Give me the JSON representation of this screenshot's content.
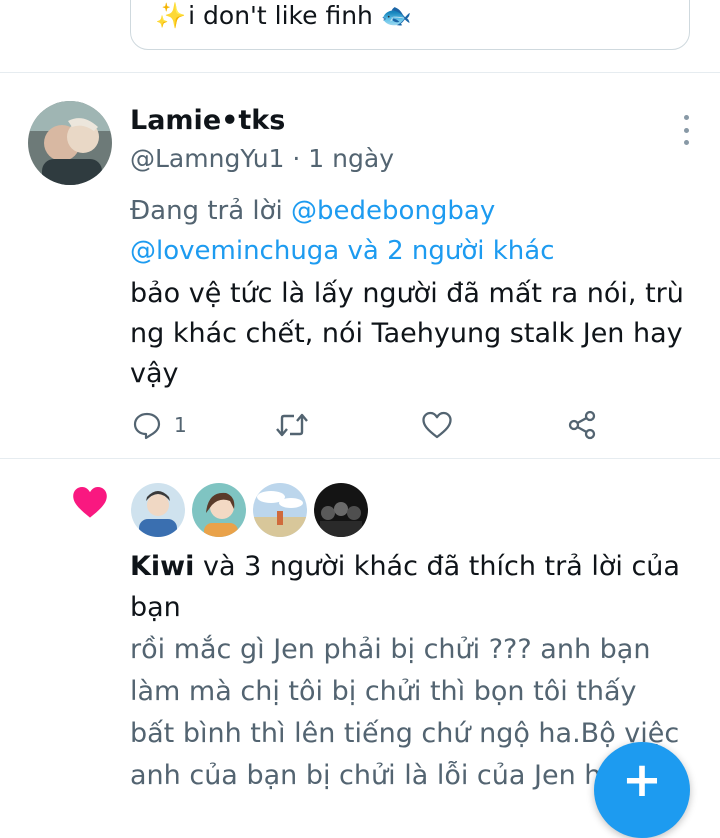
{
  "quoted_tweet": {
    "text": "i don't like finh",
    "sparkle": "✨",
    "fish": "🐟"
  },
  "tweet": {
    "name": "Lamie•tks",
    "handle_meta": "@LamngYu1 · 1 ngày",
    "reply_prefix": "Đang trả lời ",
    "mention_1": "@bedebongbay",
    "mention_2": "@loveminchuga và 2 người khác",
    "body_lines": [
      "bảo vệ tức là lấy người đã mất ra nói, trù",
      "ng khác chết, nói Taehyung stalk Jen hay",
      "vậy"
    ],
    "reply_count": "1",
    "icons": [
      "reply-icon",
      "retweet-icon",
      "like-icon",
      "share-icon",
      "more-icon"
    ]
  },
  "notification": {
    "liker_name": "Kiwi",
    "line_1_rest": " và 3 người khác đã thích trả lời của",
    "line_2": "bạn",
    "preview_lines": [
      "rồi mắc gì Jen phải bị chửi ??? anh bạn",
      "làm mà chị tôi bị chửi thì bọn tôi thấy",
      "bất bình thì lên tiếng chứ ngộ ha.Bộ việc",
      "anh của bạn bị chửi là lỗi của Jen h"
    ]
  },
  "colors": {
    "accent": "#1d9bf0",
    "heart": "#f91880",
    "muted": "#536471"
  }
}
